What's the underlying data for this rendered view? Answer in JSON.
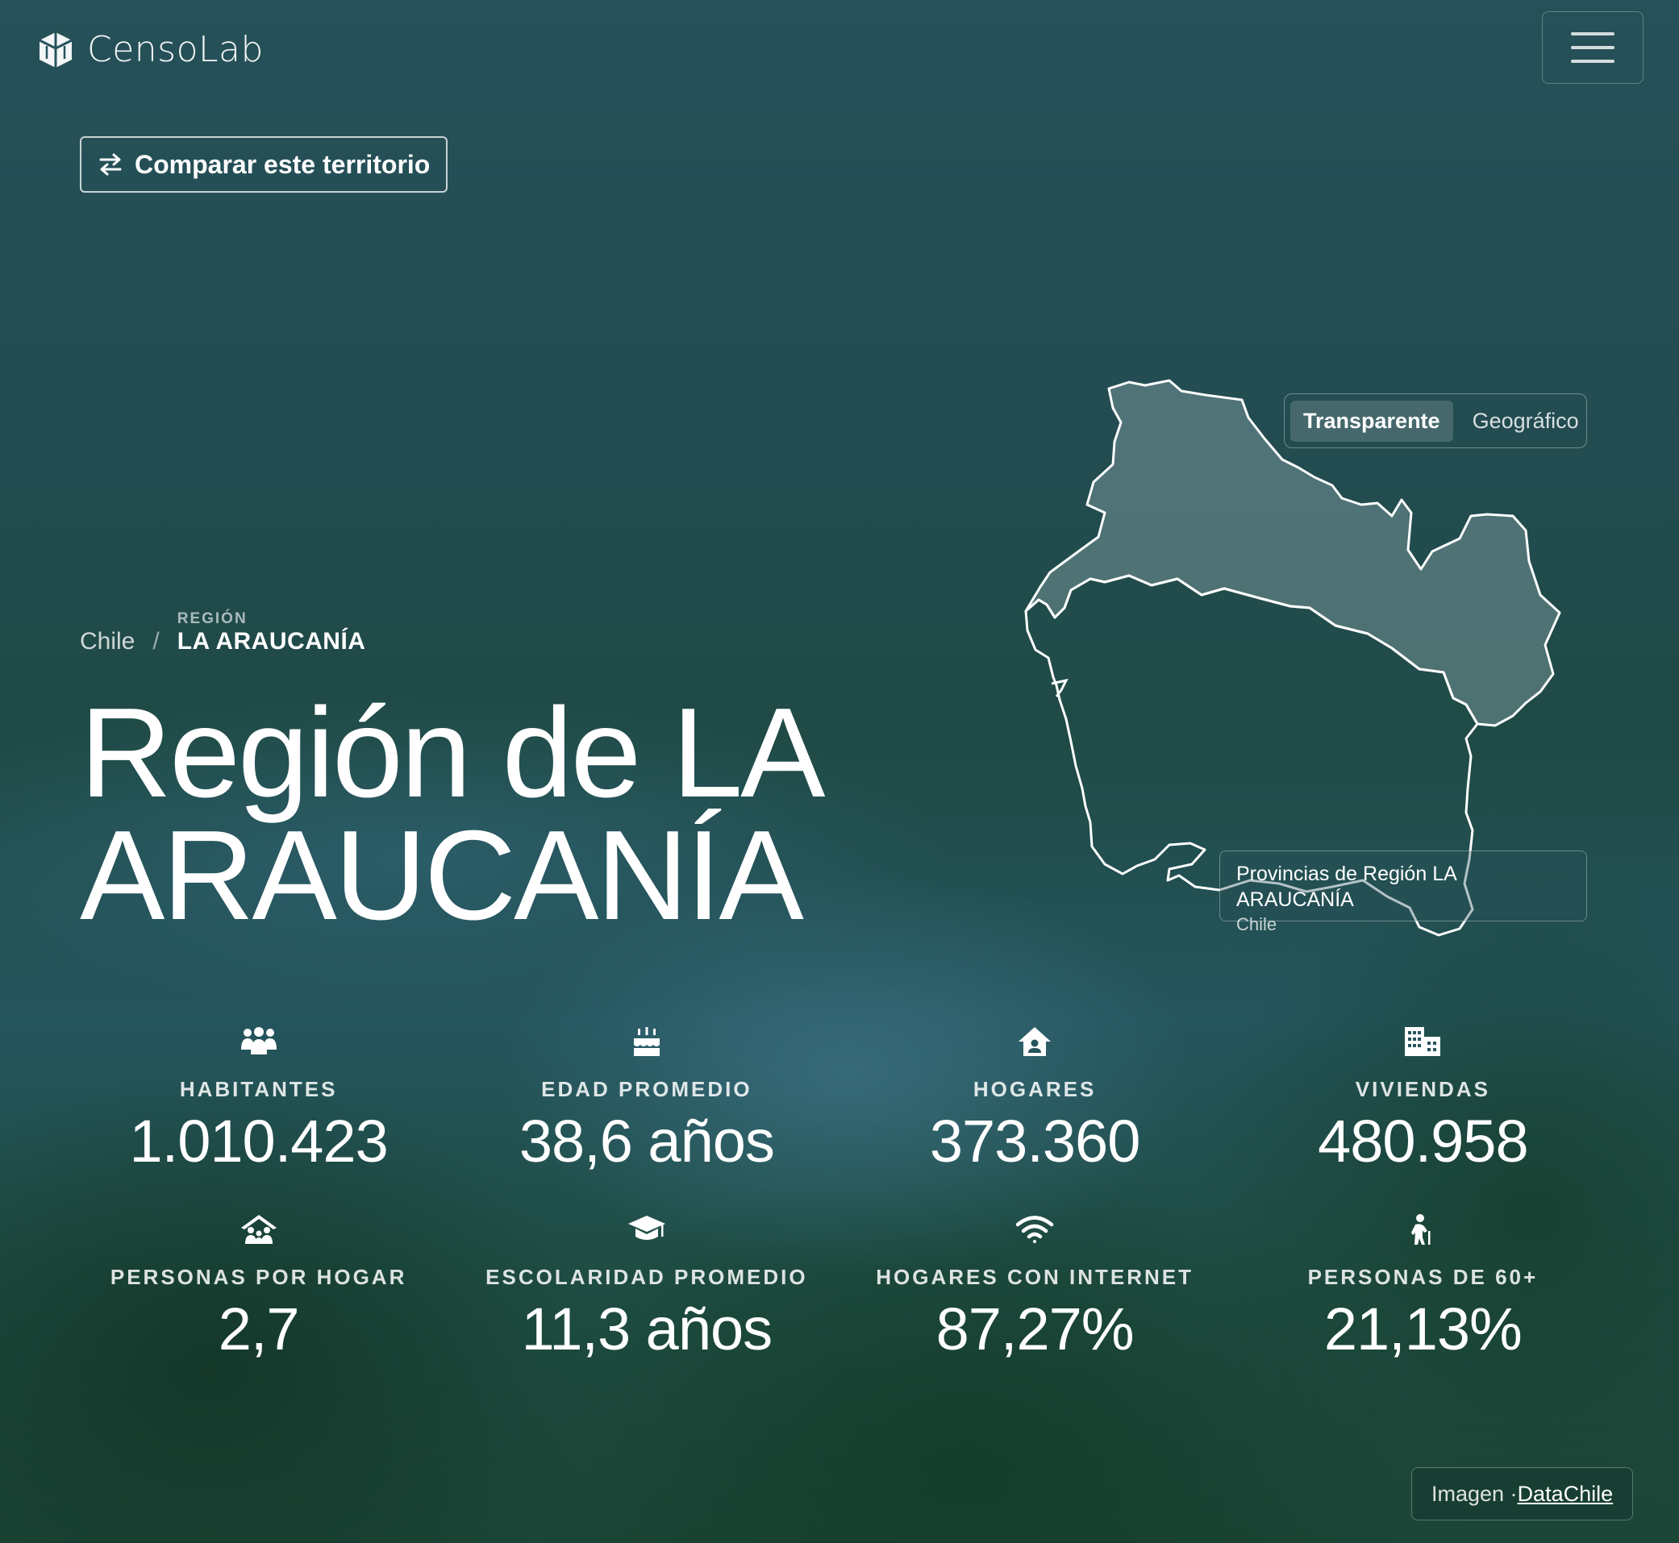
{
  "app": {
    "name": "CensoLab"
  },
  "header": {
    "menu_icon": "hamburger-icon",
    "logo_icon": "cube-logo-icon"
  },
  "compare": {
    "label": "Comparar este territorio",
    "icon": "swap-arrows-icon"
  },
  "breadcrumb": {
    "root": "Chile",
    "separator": "/",
    "kicker": "REGIÓN",
    "current": "LA ARAUCANÍA"
  },
  "title": {
    "line1": "Región de LA",
    "line2": "ARAUCANÍA"
  },
  "map": {
    "toggle": {
      "options": [
        "Transparente",
        "Geográfico"
      ],
      "selected": "Transparente"
    },
    "caption": {
      "title": "Provincias de Región LA ARAUCANÍA",
      "subtitle": "Chile"
    }
  },
  "stats": [
    {
      "icon": "people-group-icon",
      "label": "HABITANTES",
      "value": "1.010.423"
    },
    {
      "icon": "birthday-cake-icon",
      "label": "EDAD PROMEDIO",
      "value": "38,6 años"
    },
    {
      "icon": "house-user-icon",
      "label": "HOGARES",
      "value": "373.360"
    },
    {
      "icon": "buildings-icon",
      "label": "VIVIENDAS",
      "value": "480.958"
    },
    {
      "icon": "family-roof-icon",
      "label": "PERSONAS POR HOGAR",
      "value": "2,7"
    },
    {
      "icon": "graduation-cap-icon",
      "label": "ESCOLARIDAD PROMEDIO",
      "value": "11,3 años"
    },
    {
      "icon": "wifi-icon",
      "label": "HOGARES CON INTERNET",
      "value": "87,27%"
    },
    {
      "icon": "elderly-person-icon",
      "label": "PERSONAS DE 60+",
      "value": "21,13%"
    }
  ],
  "credit": {
    "prefix": "Imagen · ",
    "link": "DataChile"
  },
  "colors": {
    "background": "#26535c",
    "text": "#ffffff",
    "map_fill": "#8fa9ad"
  }
}
